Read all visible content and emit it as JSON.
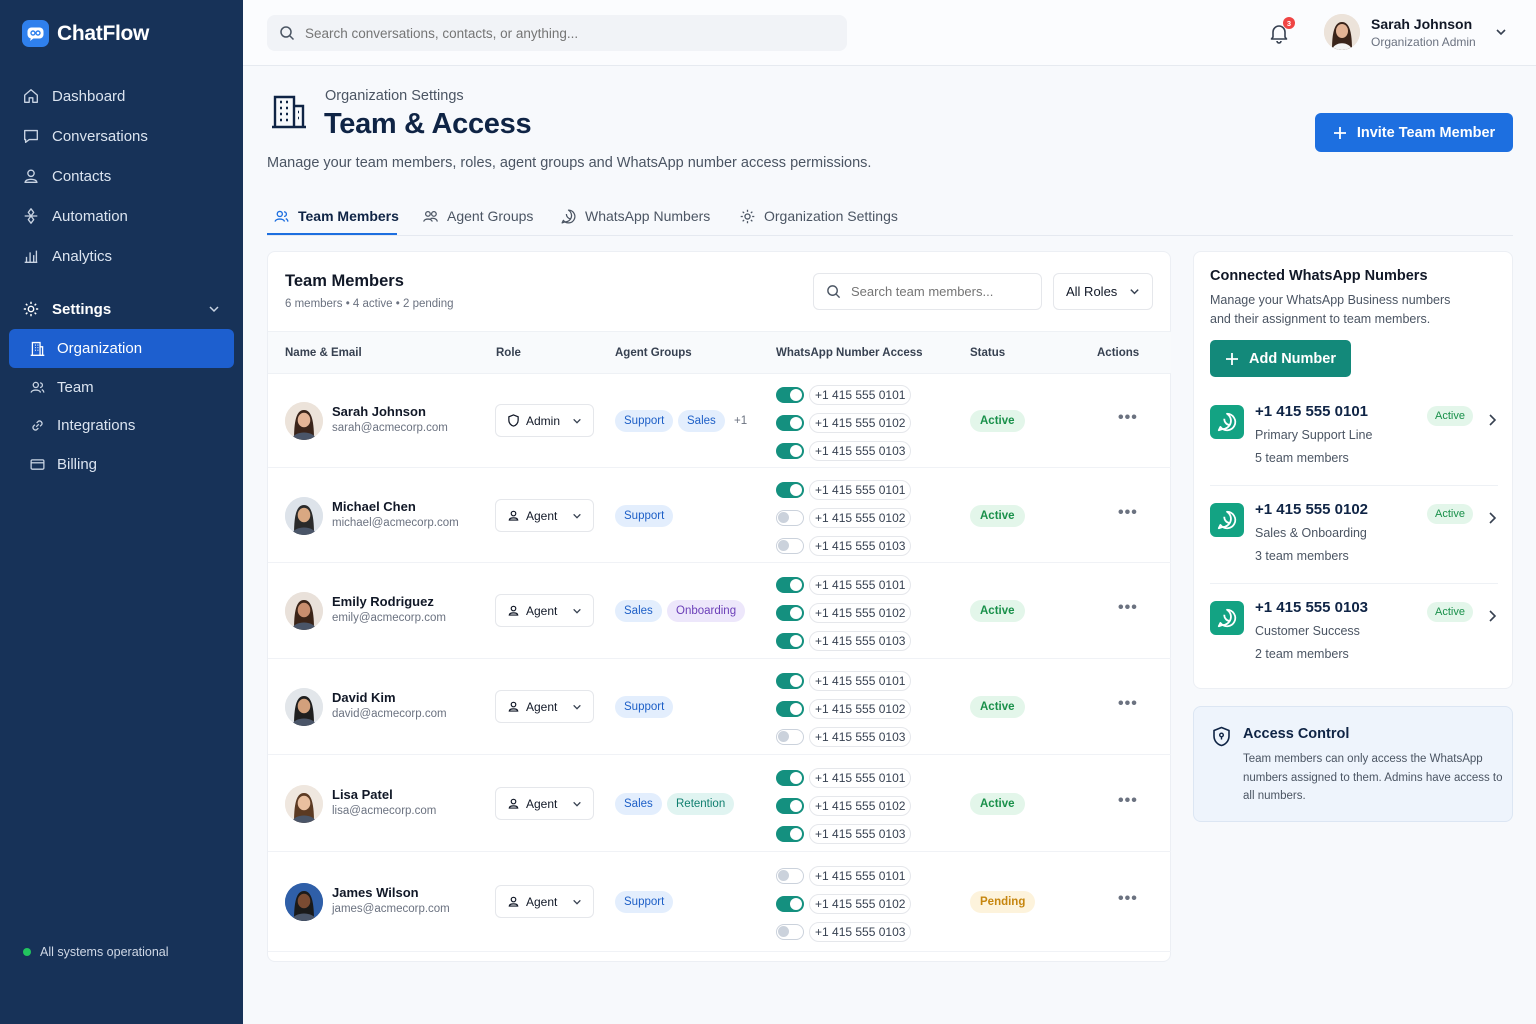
{
  "app": {
    "name": "ChatFlow"
  },
  "sidebar": {
    "items": [
      {
        "label": "Dashboard",
        "icon": "home-icon"
      },
      {
        "label": "Conversations",
        "icon": "chat-icon"
      },
      {
        "label": "Contacts",
        "icon": "user-icon"
      },
      {
        "label": "Automation",
        "icon": "automation-icon"
      },
      {
        "label": "Analytics",
        "icon": "chart-icon"
      }
    ],
    "settings_label": "Settings",
    "sub_items": [
      {
        "label": "Organization",
        "icon": "building-icon",
        "active": true
      },
      {
        "label": "Team",
        "icon": "users-icon"
      },
      {
        "label": "Integrations",
        "icon": "link-icon"
      },
      {
        "label": "Billing",
        "icon": "card-icon"
      }
    ],
    "status": "All systems operational"
  },
  "topbar": {
    "search_placeholder": "Search conversations, contacts, or anything...",
    "notification_count": "3",
    "user_name": "Sarah Johnson",
    "user_role": "Organization Admin"
  },
  "page": {
    "breadcrumb": "Organization Settings",
    "title": "Team & Access",
    "description": "Manage your team members, roles, agent groups and WhatsApp number access permissions.",
    "invite_label": "Invite Team Member"
  },
  "tabs": [
    {
      "label": "Team Members",
      "icon": "users-icon",
      "active": true
    },
    {
      "label": "Agent Groups",
      "icon": "group-icon"
    },
    {
      "label": "WhatsApp Numbers",
      "icon": "whatsapp-icon"
    },
    {
      "label": "Organization Settings",
      "icon": "gear-icon"
    }
  ],
  "team": {
    "title": "Team Members",
    "subtitle": "6 members • 4 active • 2 pending",
    "search_placeholder": "Search team members...",
    "role_filter": "All Roles",
    "columns": [
      "Name & Email",
      "Role",
      "Agent Groups",
      "WhatsApp Number Access",
      "Status",
      "Actions"
    ],
    "numbers": [
      "+1 415 555 0101",
      "+1 415 555 0102",
      "+1 415 555 0103"
    ],
    "members": [
      {
        "name": "Sarah Johnson",
        "email": "sarah@acmecorp.com",
        "role": "Admin",
        "groups": [
          {
            "label": "Support",
            "color": "blue"
          },
          {
            "label": "Sales",
            "color": "blue"
          },
          {
            "label": "+1",
            "color": "gray"
          }
        ],
        "access": [
          true,
          true,
          true
        ],
        "status": "Active"
      },
      {
        "name": "Michael Chen",
        "email": "michael@acmecorp.com",
        "role": "Agent",
        "groups": [
          {
            "label": "Support",
            "color": "blue"
          }
        ],
        "access": [
          true,
          false,
          false
        ],
        "status": "Active"
      },
      {
        "name": "Emily Rodriguez",
        "email": "emily@acmecorp.com",
        "role": "Agent",
        "groups": [
          {
            "label": "Sales",
            "color": "blue"
          },
          {
            "label": "Onboarding",
            "color": "purple"
          }
        ],
        "access": [
          true,
          true,
          true
        ],
        "status": "Active"
      },
      {
        "name": "David Kim",
        "email": "david@acmecorp.com",
        "role": "Agent",
        "groups": [
          {
            "label": "Support",
            "color": "blue"
          }
        ],
        "access": [
          true,
          true,
          false
        ],
        "status": "Active"
      },
      {
        "name": "Lisa Patel",
        "email": "lisa@acmecorp.com",
        "role": "Agent",
        "groups": [
          {
            "label": "Sales",
            "color": "blue"
          },
          {
            "label": "Retention",
            "color": "teal"
          }
        ],
        "access": [
          true,
          true,
          true
        ],
        "status": "Active"
      },
      {
        "name": "James Wilson",
        "email": "james@acmecorp.com",
        "role": "Agent",
        "groups": [
          {
            "label": "Support",
            "color": "blue"
          }
        ],
        "access": [
          false,
          true,
          false
        ],
        "status": "Pending"
      }
    ]
  },
  "whatsapp": {
    "title": "Connected WhatsApp Numbers",
    "description": "Manage your WhatsApp Business numbers and their assignment to team members.",
    "add_label": "Add Number",
    "numbers": [
      {
        "number": "+1 415 555 0101",
        "label": "Primary Support Line",
        "members": "5 team members",
        "status": "Active"
      },
      {
        "number": "+1 415 555 0102",
        "label": "Sales & Onboarding",
        "members": "3 team members",
        "status": "Active"
      },
      {
        "number": "+1 415 555 0103",
        "label": "Customer Success",
        "members": "2 team members",
        "status": "Active"
      }
    ]
  },
  "access_control": {
    "title": "Access Control",
    "text": "Team members can only access the WhatsApp numbers assigned to them. Admins have access to all numbers."
  },
  "colors": {
    "sidebar": "#173258",
    "accent": "#1d6fe0",
    "whatsapp": "#13897a",
    "active": "#19904a",
    "pending": "#c6860f"
  }
}
